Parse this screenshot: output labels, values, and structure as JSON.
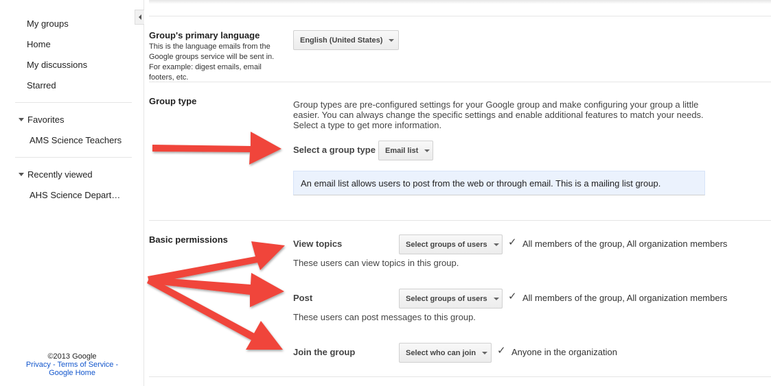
{
  "sidebar": {
    "nav": [
      "My groups",
      "Home",
      "My discussions",
      "Starred"
    ],
    "favorites": {
      "heading": "Favorites",
      "items": [
        "AMS Science Teachers"
      ]
    },
    "recent": {
      "heading": "Recently viewed",
      "items": [
        "AHS Science Department"
      ]
    },
    "footer": {
      "copyright": "©2013 Google",
      "privacy": "Privacy",
      "sep1": " - ",
      "terms": "Terms of Service",
      "sep2": " -",
      "home": "Google Home"
    }
  },
  "language": {
    "title": "Group's primary language",
    "description": "This is the language emails from the Google groups service will be sent in. For example: digest emails, email footers, etc.",
    "selected": "English (United States)"
  },
  "group_type": {
    "title": "Group type",
    "intro": "Group types are pre-configured settings for your Google group and make configuring your group a little easier. You can always change the specific settings and enable additional features to match your needs. Select a type to get more information.",
    "select_label": "Select a group type",
    "selected": "Email list",
    "info": "An email list allows users to post from the web or through email. This is a mailing list group."
  },
  "permissions": {
    "title": "Basic permissions",
    "view": {
      "label": "View topics",
      "dropdown": "Select groups of users",
      "value": "All members of the group, All organization members",
      "note": "These users can view topics in this group."
    },
    "post": {
      "label": "Post",
      "dropdown": "Select groups of users",
      "value": "All members of the group, All organization members",
      "note": "These users can post messages to this group."
    },
    "join": {
      "label": "Join the group",
      "dropdown": "Select who can join",
      "value": "Anyone in the organization"
    }
  },
  "icons": {
    "check": "checkmark-icon",
    "arrow_color": "#f0453a"
  }
}
